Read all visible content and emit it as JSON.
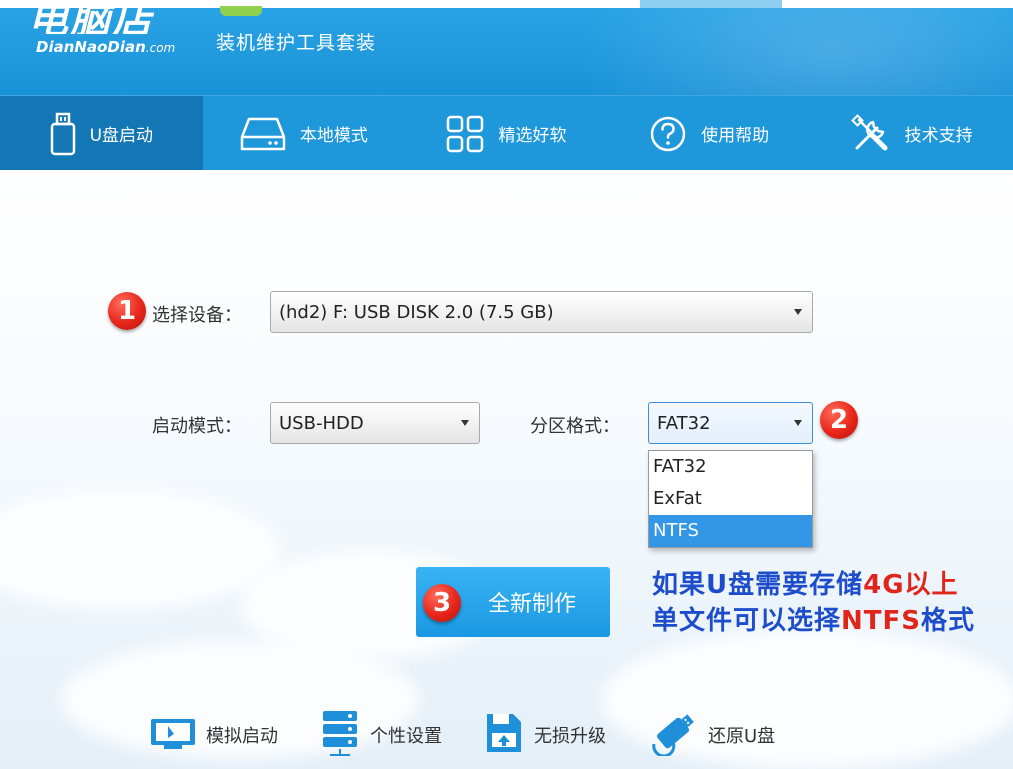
{
  "header": {
    "logo_cn": "电脑店",
    "logo_en": "DianNaoDian",
    "logo_domain": ".com",
    "tagline": "装机维护工具套装"
  },
  "nav": {
    "items": [
      {
        "label": "U盘启动",
        "icon": "usb-drive-icon",
        "active": true
      },
      {
        "label": "本地模式",
        "icon": "hard-disk-icon",
        "active": false
      },
      {
        "label": "精选好软",
        "icon": "app-grid-icon",
        "active": false
      },
      {
        "label": "使用帮助",
        "icon": "help-icon",
        "active": false
      },
      {
        "label": "技术支持",
        "icon": "tools-icon",
        "active": false
      }
    ]
  },
  "form": {
    "device_label": "选择设备：",
    "device_value": "(hd2) F: USB DISK 2.0 (7.5 GB)",
    "boot_mode_label": "启动模式：",
    "boot_mode_value": "USB-HDD",
    "partition_label": "分区格式：",
    "partition_value": "FAT32",
    "partition_options": [
      "FAT32",
      "ExFat",
      "NTFS"
    ],
    "partition_highlighted": "NTFS"
  },
  "steps": [
    "1",
    "2",
    "3"
  ],
  "make_button_label": "全新制作",
  "note": {
    "line1_a": "如果U盘需要存储",
    "line1_b": "4G以上",
    "line2_a": "单文件可以选择",
    "line2_b": "NTFS",
    "line2_c": "格式"
  },
  "bottom": {
    "items": [
      {
        "label": "模拟启动",
        "icon": "monitor-icon"
      },
      {
        "label": "个性设置",
        "icon": "server-settings-icon"
      },
      {
        "label": "无损升级",
        "icon": "upgrade-icon"
      },
      {
        "label": "还原U盘",
        "icon": "restore-usb-icon"
      }
    ]
  },
  "colors": {
    "header_blue": "#1f97db",
    "nav_active": "#1376b5",
    "button_blue": "#1a98e2",
    "note_blue": "#1e4dcb",
    "note_red": "#e0251b",
    "badge_red": "#e8261a"
  }
}
